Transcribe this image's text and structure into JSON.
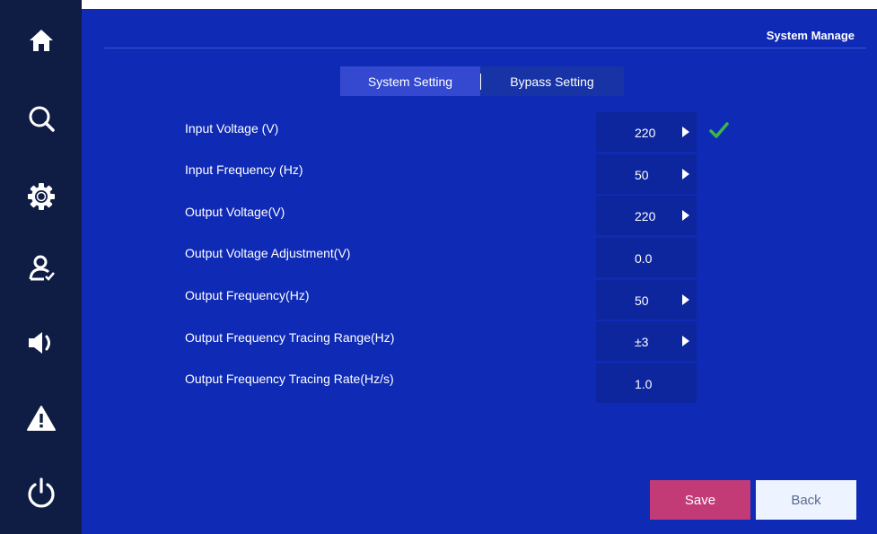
{
  "header": {
    "title": "System Manage"
  },
  "tabs": [
    {
      "label": "System Setting",
      "active": true
    },
    {
      "label": "Bypass Setting",
      "active": false
    }
  ],
  "settings": [
    {
      "label": "Input Voltage (V)",
      "value": "220",
      "has_arrow": true,
      "confirmed": true
    },
    {
      "label": "Input Frequency (Hz)",
      "value": "50",
      "has_arrow": true
    },
    {
      "label": "Output Voltage(V)",
      "value": "220",
      "has_arrow": true
    },
    {
      "label": "Output Voltage Adjustment(V)",
      "value": "0.0",
      "has_arrow": false
    },
    {
      "label": "Output Frequency(Hz)",
      "value": "50",
      "has_arrow": true
    },
    {
      "label": "Output Frequency Tracing Range(Hz)",
      "value": "±3",
      "has_arrow": true
    },
    {
      "label": "Output Frequency Tracing Rate(Hz/s)",
      "value": "1.0",
      "has_arrow": false
    }
  ],
  "buttons": {
    "save": "Save",
    "back": "Back"
  },
  "sidebar": {
    "items": [
      {
        "icon": "home-icon"
      },
      {
        "icon": "search-icon"
      },
      {
        "icon": "gear-icon"
      },
      {
        "icon": "user-manage-icon"
      },
      {
        "icon": "speaker-icon"
      },
      {
        "icon": "warning-icon"
      },
      {
        "icon": "power-icon"
      }
    ]
  },
  "colors": {
    "sidebar_bg": "#0f1c44",
    "main_bg": "#0f2ab5",
    "active_tab": "#3449cf",
    "value_box": "#0d269e",
    "save_button": "#c23b76",
    "back_button": "#eef4ff",
    "check": "#3cb54a"
  }
}
